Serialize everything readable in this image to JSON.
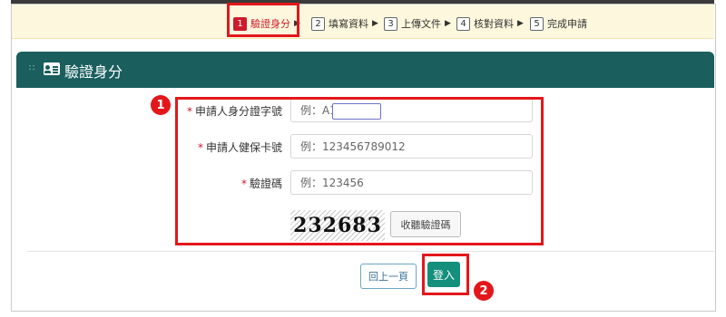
{
  "steps": [
    {
      "num": "1",
      "label": "驗證身分",
      "active": true
    },
    {
      "num": "2",
      "label": "填寫資料"
    },
    {
      "num": "3",
      "label": "上傳文件"
    },
    {
      "num": "4",
      "label": "核對資料"
    },
    {
      "num": "5",
      "label": "完成申請"
    }
  ],
  "panel": {
    "title": "驗證身分"
  },
  "form": {
    "required_mark": "*",
    "id_label": "申請人身分證字號",
    "id_placeholder": "例：A1          9",
    "card_label": "申請人健保卡號",
    "card_placeholder": "例：123456789012",
    "code_label": "驗證碼",
    "code_placeholder": "例：123456",
    "captcha_text": "232683",
    "audio_button": "收聽驗證碼"
  },
  "actions": {
    "back": "回上一頁",
    "login": "登入"
  },
  "annotations": {
    "badge1": "1",
    "badge2": "2"
  },
  "colors": {
    "header": "#1a5e5e",
    "active_step": "#cc1c2b",
    "login": "#138f7c",
    "highlight": "#e3171b"
  }
}
